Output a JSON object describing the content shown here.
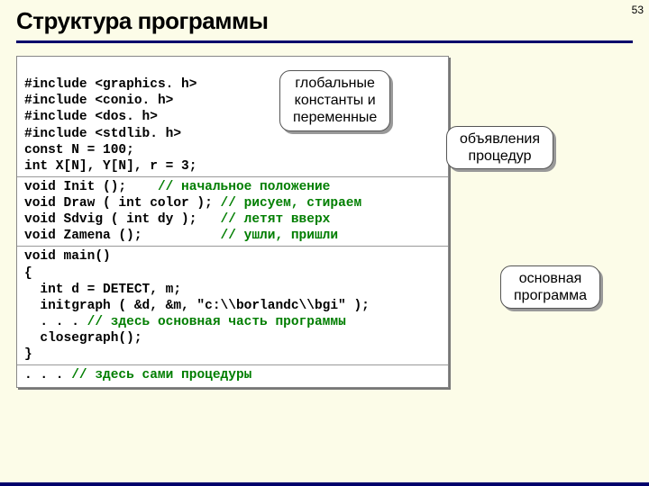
{
  "page_number": "53",
  "title": "Структура программы",
  "code": {
    "l1a": "#include ",
    "l1b": "<graphics. h>",
    "l2a": "#include ",
    "l2b": "<conio. h>",
    "l3a": "#include ",
    "l3b": "<dos. h>",
    "l4a": "#include ",
    "l4b": "<stdlib. h>",
    "l5": "const N = 100;",
    "l6": "int X[N], Y[N], r = 3;",
    "l7a": "void Init ();    ",
    "l7b": "// начальное положение",
    "l8a": "void Draw ( int color ); ",
    "l8b": "// рисуем, стираем",
    "l9a": "void Sdvig ( int dy );   ",
    "l9b": "// летят вверх",
    "l10a": "void Zamena ();          ",
    "l10b": "// ушли, пришли",
    "l11": "void main()",
    "l12": "{",
    "l13": "  int d = DETECT, m;",
    "l14": "  initgraph ( &d, &m, \"c:\\\\borlandc\\\\bgi\" );",
    "l15a": "  . . . ",
    "l15b": "// здесь основная часть программы",
    "l16": "  closegraph();",
    "l17": "}",
    "l18a": ". . . ",
    "l18b": "// здесь сами процедуры"
  },
  "callouts": {
    "c1_line1": "глобальные",
    "c1_line2": "константы и",
    "c1_line3": "переменные",
    "c2_line1": "объявления",
    "c2_line2": "процедур",
    "c3_line1": "основная",
    "c3_line2": "программа"
  }
}
